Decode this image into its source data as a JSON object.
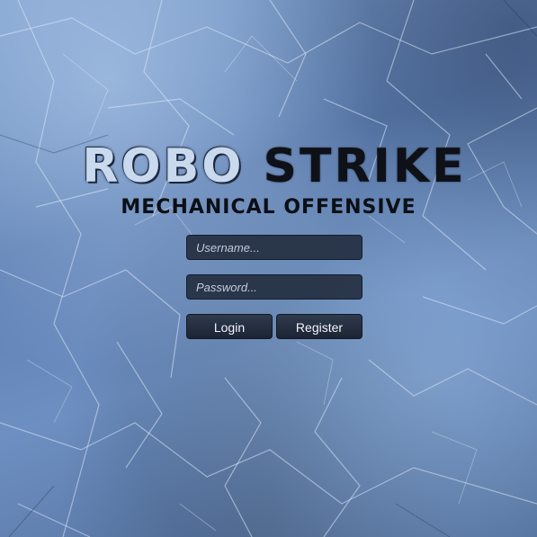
{
  "title": {
    "word1": "ROBO",
    "word2": "STRIKE",
    "subtitle": "MECHANICAL OFFENSIVE"
  },
  "login_form": {
    "username_placeholder": "Username...",
    "password_placeholder": "Password...",
    "login_label": "Login",
    "register_label": "Register"
  },
  "colors": {
    "background": "#5f7fae",
    "title_light": "#c9d9ee",
    "title_dark": "#0e1118",
    "field_bg": "#202838"
  }
}
